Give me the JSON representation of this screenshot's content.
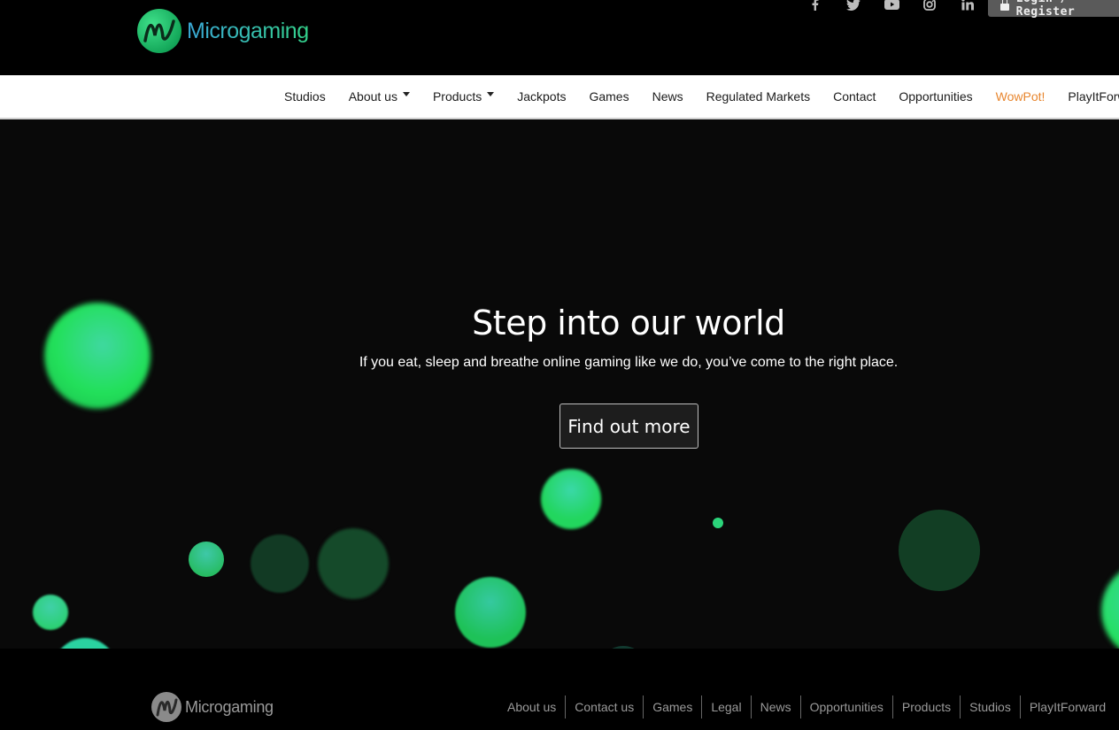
{
  "header": {
    "brand": "Microgaming",
    "social_icons": [
      "facebook-icon",
      "twitter-icon",
      "youtube-icon",
      "instagram-icon",
      "linkedin-icon"
    ],
    "login_label": "Login / Register"
  },
  "nav": {
    "items": [
      {
        "label": "Studios"
      },
      {
        "label": "About us",
        "dropdown": true
      },
      {
        "label": "Products",
        "dropdown": true
      },
      {
        "label": "Jackpots"
      },
      {
        "label": "Games"
      },
      {
        "label": "News"
      },
      {
        "label": "Regulated Markets"
      },
      {
        "label": "Contact"
      },
      {
        "label": "Opportunities"
      },
      {
        "label": "WowPot!",
        "highlight": true
      },
      {
        "label": "PlayItForward"
      }
    ]
  },
  "hero": {
    "title": "Step into our world",
    "subtitle": "If you eat, sleep and breathe online gaming like we do, you’ve come to the right place.",
    "cta_label": "Find out more"
  },
  "footer": {
    "brand": "Microgaming",
    "links": [
      "About us",
      "Contact us",
      "Games",
      "Legal",
      "News",
      "Opportunities",
      "Products",
      "Studios",
      "PlayItForward"
    ]
  },
  "colors": {
    "accent_orange": "#e8862e",
    "brand_green": "#33d28a",
    "brand_blue": "#3aa8d8"
  }
}
